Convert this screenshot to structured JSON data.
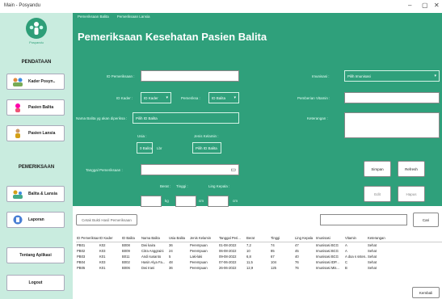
{
  "window": {
    "title": "Main - Posyandu",
    "minimize": "–",
    "maximize": "▢",
    "close": "✕"
  },
  "sidebar": {
    "logo_text": "Posyandu",
    "section_pendataan": "PENDATAAN",
    "kader": "Kader Posyn..",
    "pasien_balita": "Pasien Balita",
    "pasien_lansia": "Pasien Lansia",
    "section_pemeriksaan": "PEMERIKSAAN",
    "balita_lansia": "Balita & Lansia",
    "laporan": "Laporan",
    "tentang": "Tentang Aplikasi",
    "logout": "Logout"
  },
  "tabs": [
    "Pemeriksaan Balita",
    "Pemeriksaan Lansia"
  ],
  "page_title": "Pemeriksaan Kesehatan Pasien Balita",
  "form": {
    "id_label": "ID Pemeriksaan :",
    "kader_label": "ID Kader :",
    "kader_value": "ID Kader",
    "petugas_label": "Pemeriksa :",
    "balita_value": "ID Balita",
    "nama_label": "Nama Balita yg akan diperiksa :",
    "nama_value": "Pilih ID Balita",
    "usia_label": "Usia :",
    "usia_value": "0 Balita",
    "usia_unit": "Lbr",
    "jk_label": "Jenis Kelamin :",
    "jk_value": "Pilih ID Balita",
    "tanggal_label": "Tanggal Pemeriksaan :",
    "berat_label": "Berat :",
    "berat_unit": "kg",
    "tinggi_label": "Tinggi :",
    "tinggi_unit": "cm",
    "lk_label": "Ling Kepala :",
    "lk_unit": "cm",
    "imunisasi_label": "Imunisasi :",
    "imunisasi_value": "Pilih Imunisasi",
    "vitamin_label": "Pemberian Vitamin :",
    "keterangan_label": "Keterangan :",
    "calendar_icon": "calendar-icon"
  },
  "buttons": {
    "simpan": "Simpan",
    "refresh": "Refresh",
    "edit": "Edit",
    "hapus": "Hapus",
    "cari": "Cari",
    "kembali": "Kembali"
  },
  "search": {
    "placeholder": "Cetak Bukti Hasil Pemeriksaan"
  },
  "table": {
    "headers": [
      "ID Pemeriksaan",
      "ID Kader",
      "ID Balita",
      "Nama Balita",
      "Usia Balita",
      "Jenis Kelamin",
      "Tanggal Peri...",
      "Berat",
      "Tinggi",
      "Ling Kepala",
      "Imunisasi",
      "Vitamin",
      "Keterangan"
    ],
    "rows": [
      [
        "PB01",
        "K02",
        "B008",
        "Dwi kaira",
        "36",
        "Perempuan",
        "01-08-2022",
        "7,2",
        "74",
        "47",
        "Imunisasi BCG",
        "A",
        "Sehat"
      ],
      [
        "PB02",
        "K03",
        "B009",
        "Citra Anggraini",
        "24",
        "Perempuan",
        "06-08-2022",
        "10",
        "85",
        "45",
        "Imunisasi BCG",
        "A",
        "Sehat"
      ],
      [
        "PB03",
        "K01",
        "B011",
        "Andi susanto",
        "5",
        "Laki-laki",
        "09-08-2022",
        "6,8",
        "67",
        "40",
        "Imunisasi BCG",
        "A doa s ssten...",
        "Sehat"
      ],
      [
        "PB04",
        "K03",
        "B002",
        "Hasin Alya Fa...",
        "48",
        "Perempuan",
        "07-06-2022",
        "11,5",
        "104",
        "76",
        "Imunisasi IDP...",
        "C",
        "Sehat"
      ],
      [
        "PB05",
        "K01",
        "B006",
        "Dwi Irani",
        "36",
        "Perempuan",
        "26-06-2022",
        "12,9",
        "125",
        "76",
        "Imunisasi Mis...",
        "B",
        "Sehat"
      ]
    ]
  },
  "colors": {
    "sidebar": "#c9ecdf",
    "accent": "#2fa07b"
  }
}
